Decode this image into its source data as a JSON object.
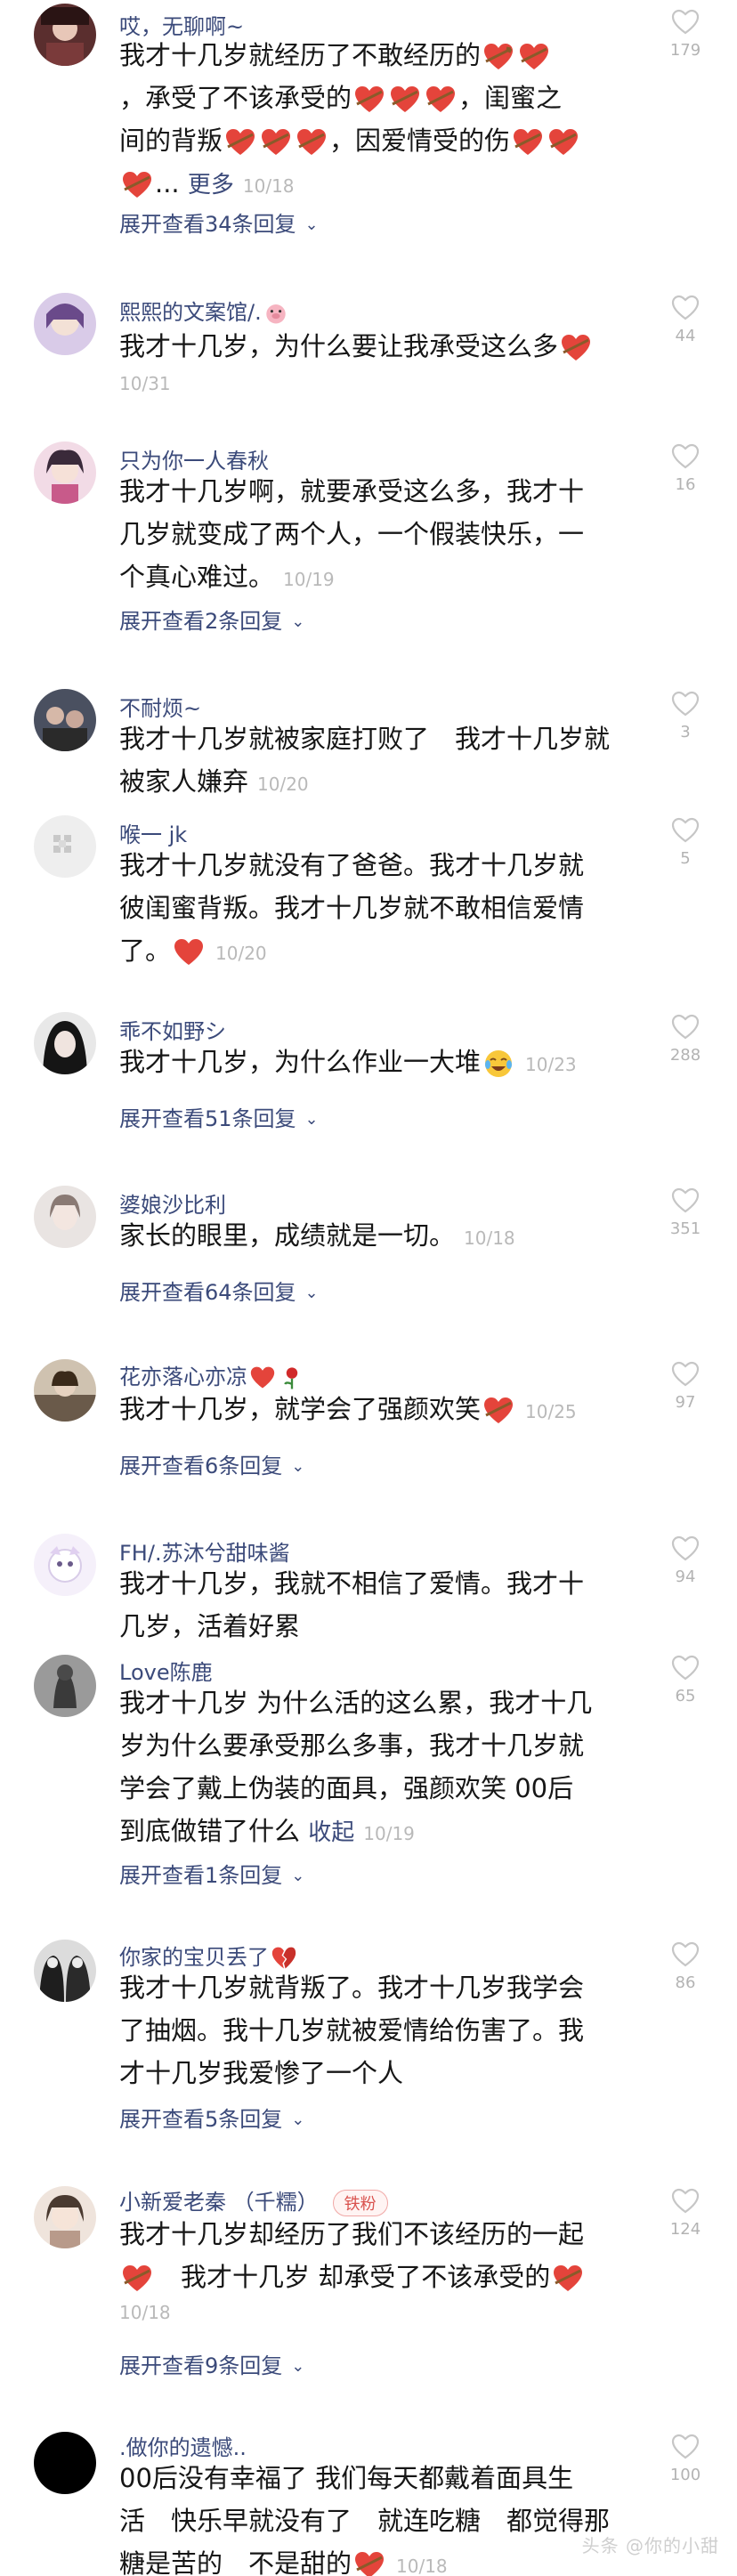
{
  "comments": [
    {
      "name": "哎，无聊啊~",
      "text": "我才十几岁就经历了不敢经历的 💘 💘，承受了不该承受的 💘 💘 💘 ，闺蜜之间的背叛 💘 💘 💘 ，因爱情受的伤 💘 💘 💘 ...",
      "more": "更多",
      "date": "10/18",
      "likes": "179",
      "replies": "展开查看34条回复",
      "avatar_color": "#7a3a3a"
    },
    {
      "name": "熙熙的文案馆/.",
      "text": "我才十几岁，为什么要让我承受这么多 💘",
      "date": "10/31",
      "likes": "44",
      "avatar_color": "#8a6aa8"
    },
    {
      "name": "只为你一人春秋",
      "text": "我才十几岁啊，就要承受这么多，我才十几岁就变成了两个人，一个假装快乐，一个真心难过。",
      "date": "10/19",
      "likes": "16",
      "replies": "展开查看2条回复",
      "avatar_color": "#b86a8a"
    },
    {
      "name": "不耐烦~",
      "text": "我才十几岁就被家庭打败了　我才十几岁就被家人嫌弃",
      "date": "10/20",
      "likes": "3",
      "avatar_color": "#3a3a3a"
    },
    {
      "name": "喉一 jk",
      "text": "我才十几岁就没有了爸爸。我才十几岁就彼闺蜜背叛。我才十几岁就不敢相信爱情了。",
      "date": "10/20",
      "likes": "5",
      "avatar_color": "#d9d9d9"
    },
    {
      "name": "乖不如野シ",
      "text": "我才十几岁，为什么作业一大堆",
      "date": "10/23",
      "likes": "288",
      "replies": "展开查看51条回复",
      "avatar_color": "#222222"
    },
    {
      "name": "婆娘沙比利",
      "text": "家长的眼里，成绩就是一切。",
      "date": "10/18",
      "likes": "351",
      "replies": "展开查看64条回复",
      "avatar_color": "#c9b8b0"
    },
    {
      "name": "花亦落心亦凉",
      "text": "我才十几岁，就学会了强颜欢笑 💘",
      "date": "10/25",
      "likes": "97",
      "replies": "展开查看6条回复",
      "avatar_color": "#6a5a4a"
    },
    {
      "name": "FH/.苏沐兮甜味酱",
      "text": "我才十几岁，我就不相信了爱情。我才十几岁，活着好累",
      "likes": "94",
      "avatar_color": "#e6dcef"
    },
    {
      "name": "Love陈鹿",
      "text": "我才十几岁 为什么活的这么累，我才十几岁为什么要承受那么多事，我才十几岁就学会了戴上伪装的面具，强颜欢笑 00后到底做错了什么",
      "more": "收起",
      "date": "10/19",
      "likes": "65",
      "replies": "展开查看1条回复",
      "avatar_color": "#4a4a4a"
    },
    {
      "name": "你家的宝贝丢了",
      "text": "我才十几岁就背叛了。我才十几岁我学会了抽烟。我十几岁就被爱情给伤害了。我才十几岁我爱惨了一个人",
      "likes": "86",
      "replies": "展开查看5条回复",
      "avatar_color": "#2e2e2e"
    },
    {
      "name": "小新爱老秦 （千糯）",
      "badge": "铁粉",
      "text": "我才十几岁却经历了我们不该经历的一起 💘 我才十几岁 却承受了不该承受的 💘",
      "date": "10/18",
      "likes": "124",
      "replies": "展开查看9条回复",
      "avatar_color": "#9a7a6a"
    },
    {
      "name": ".做你的遗憾..",
      "text": "00后没有幸福了 我们每天都戴着面具生活 快乐早就没有了 就连吃糖 都觉得那糖是苦的 不是甜的 💘",
      "date": "10/18",
      "likes": "100",
      "avatar_color": "#000000"
    }
  ],
  "watermark": "头条 @你的小甜"
}
